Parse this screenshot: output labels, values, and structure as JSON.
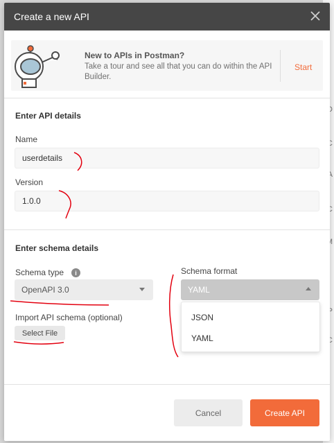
{
  "background": {
    "edge_letters": [
      "D",
      "C",
      "A",
      "C",
      "M",
      "P",
      "C"
    ]
  },
  "modal": {
    "title": "Create a new API",
    "close_icon": "close-icon"
  },
  "promo": {
    "title": "New to APIs in Postman?",
    "text": "Take a tour and see all that you can do within the API Builder.",
    "start_label": "Start",
    "accent": "#f26b3a"
  },
  "api_details": {
    "section_title": "Enter API details",
    "name_label": "Name",
    "name_value": "userdetails",
    "version_label": "Version",
    "version_value": "1.0.0"
  },
  "schema_details": {
    "section_title": "Enter schema details",
    "schema_type_label": "Schema type",
    "schema_type_value": "OpenAPI 3.0",
    "schema_format_label": "Schema format",
    "schema_format_value": "YAML",
    "schema_format_options": [
      "JSON",
      "YAML"
    ],
    "import_label": "Import API schema (optional)",
    "select_file_label": "Select File"
  },
  "footer": {
    "cancel_label": "Cancel",
    "create_label": "Create API"
  },
  "colors": {
    "header_bg": "#464646",
    "primary": "#f26b3a",
    "annotation_red": "#e3000f"
  }
}
